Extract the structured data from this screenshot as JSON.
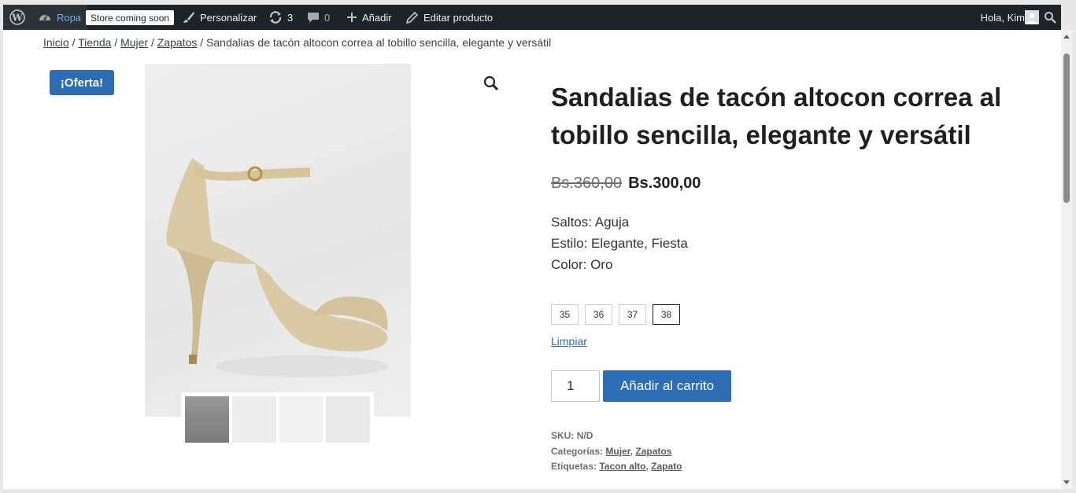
{
  "adminbar": {
    "site_name": "Ropa",
    "store_badge": "Store coming soon",
    "personalizar": "Personalizar",
    "updates_count": "3",
    "comments_count": "0",
    "add_new": "Añadir",
    "edit_product": "Editar producto",
    "greeting": "Hola, Kim"
  },
  "breadcrumb": {
    "items": [
      "Inicio",
      "Tienda",
      "Mujer",
      "Zapatos"
    ],
    "separator": "/",
    "current": "Sandalias de tacón altocon correa al tobillo sencilla, elegante y versátil"
  },
  "product": {
    "sale_badge": "¡Oferta!",
    "title_line1": "Sandalias de tacón altocon correa al",
    "title_line2": "tobillo sencilla, elegante y versátil",
    "old_price": "Bs.360,00",
    "price": "Bs.300,00",
    "attributes": [
      "Saltos: Aguja",
      "Estilo: Elegante, Fiesta",
      "Color: Oro"
    ],
    "sizes": [
      "35",
      "36",
      "37",
      "38"
    ],
    "selected_size": "38",
    "clear_label": "Limpiar",
    "quantity": "1",
    "add_to_cart": "Añadir al carrito",
    "meta": {
      "sku_label": "SKU:",
      "sku_value": "N/D",
      "categories_label": "Categorías:",
      "categories": [
        "Mujer",
        "Zapatos"
      ],
      "tags_label": "Etiquetas:",
      "tags": [
        "Tacon alto",
        "Zapato"
      ]
    }
  },
  "colors": {
    "accent": "#2c6db5",
    "adminbar": "#1d2327"
  }
}
